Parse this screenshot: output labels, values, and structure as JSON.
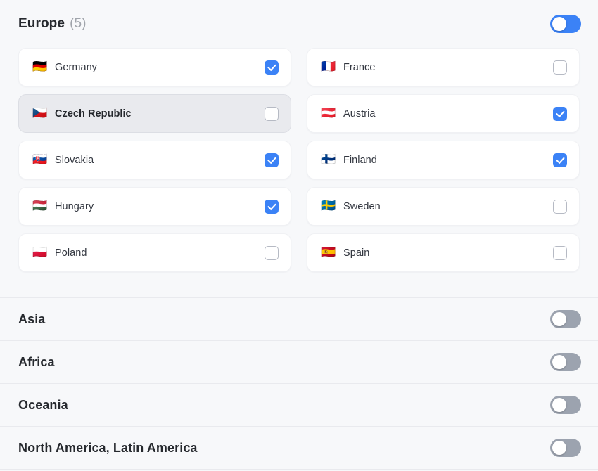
{
  "active_region": {
    "name": "Europe",
    "count_label": "(5)",
    "toggle": {
      "state": "on",
      "name": "europe-toggle"
    }
  },
  "colors": {
    "accent": "#3b82f6",
    "page_background": "#f7f8fa",
    "card_background": "#ffffff",
    "active_card_background": "#e9eaee",
    "toggle_off": "#9ca3af",
    "title_text": "#26292e",
    "muted_text": "#a0a4ab",
    "divider": "#e9eaee"
  },
  "countries": [
    {
      "name": "Germany",
      "flag": "🇩🇪",
      "checked": true,
      "active": false,
      "column": "left"
    },
    {
      "name": "France",
      "flag": "🇫🇷",
      "checked": false,
      "active": false,
      "column": "right"
    },
    {
      "name": "Czech Republic",
      "flag": "🇨🇿",
      "checked": false,
      "active": true,
      "column": "left"
    },
    {
      "name": "Austria",
      "flag": "🇦🇹",
      "checked": true,
      "active": false,
      "column": "right"
    },
    {
      "name": "Slovakia",
      "flag": "🇸🇰",
      "checked": true,
      "active": false,
      "column": "left"
    },
    {
      "name": "Finland",
      "flag": "🇫🇮",
      "checked": true,
      "active": false,
      "column": "right"
    },
    {
      "name": "Hungary",
      "flag": "🇭🇺",
      "checked": true,
      "active": false,
      "column": "left"
    },
    {
      "name": "Sweden",
      "flag": "🇸🇪",
      "checked": false,
      "active": false,
      "column": "right"
    },
    {
      "name": "Poland",
      "flag": "🇵🇱",
      "checked": false,
      "active": false,
      "column": "left"
    },
    {
      "name": "Spain",
      "flag": "🇪🇸",
      "checked": false,
      "active": false,
      "column": "right"
    }
  ],
  "collapsed_regions": [
    {
      "label": "Asia",
      "toggle_state": "off"
    },
    {
      "label": "Africa",
      "toggle_state": "off"
    },
    {
      "label": "Oceania",
      "toggle_state": "off"
    },
    {
      "label": "North America, Latin America",
      "toggle_state": "off"
    }
  ]
}
